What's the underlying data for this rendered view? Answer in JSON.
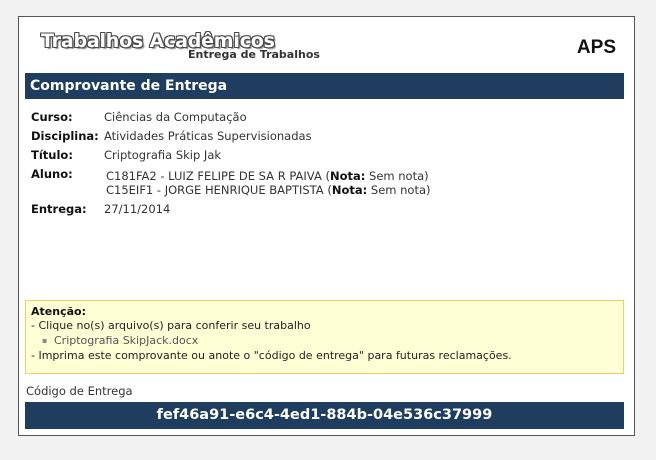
{
  "header": {
    "logo_title": "Trabalhos Acadêmicos",
    "logo_subtitle": "Entrega de Trabalhos",
    "badge": "APS"
  },
  "section": {
    "title": "Comprovante de Entrega"
  },
  "details": {
    "curso_label": "Curso:",
    "curso_value": "Ciências da Computação",
    "disciplina_label": "Disciplina:",
    "disciplina_value": "Atividades Práticas Supervisionadas",
    "titulo_label": "Título:",
    "titulo_value": "Criptografia Skip Jak",
    "aluno_label": "Aluno:",
    "alunos": [
      {
        "name": "C181FA2 - LUIZ FELIPE DE SA R PAIVA",
        "nota_prefix": "(",
        "nota_label": "Nota:",
        "nota_value": "Sem nota)"
      },
      {
        "name": "C15EIF1 - JORGE HENRIQUE BAPTISTA",
        "nota_prefix": "(",
        "nota_label": "Nota:",
        "nota_value": "Sem nota)"
      }
    ],
    "entrega_label": "Entrega:",
    "entrega_value": "27/11/2014"
  },
  "attention": {
    "title": "Atenção:",
    "line1": "- Clique no(s) arquivo(s) para conferir seu trabalho",
    "file": "Criptografia SkipJack.docx",
    "line2": "- Imprima este comprovante ou anote o \"código de entrega\" para futuras reclamações."
  },
  "code": {
    "label": "Código de Entrega",
    "value": "fef46a91-e6c4-4ed1-884b-04e536c37999"
  },
  "colors": {
    "bar": "#1f3d5e",
    "attention_bg": "#ffffd6",
    "attention_border": "#e8d36a"
  }
}
